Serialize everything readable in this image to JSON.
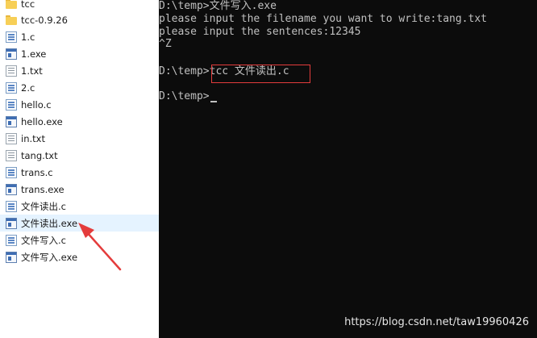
{
  "explorer": {
    "files": [
      {
        "name": "tcc",
        "icon": "folder-icon"
      },
      {
        "name": "tcc-0.9.26",
        "icon": "folder-icon"
      },
      {
        "name": "1.c",
        "icon": "c-source-file-icon"
      },
      {
        "name": "1.exe",
        "icon": "exe-file-icon"
      },
      {
        "name": "1.txt",
        "icon": "text-file-icon"
      },
      {
        "name": "2.c",
        "icon": "c-source-file-icon"
      },
      {
        "name": "hello.c",
        "icon": "c-source-file-icon"
      },
      {
        "name": "hello.exe",
        "icon": "exe-file-icon"
      },
      {
        "name": "in.txt",
        "icon": "text-file-icon"
      },
      {
        "name": "tang.txt",
        "icon": "text-file-icon"
      },
      {
        "name": "trans.c",
        "icon": "c-source-file-icon"
      },
      {
        "name": "trans.exe",
        "icon": "exe-file-icon"
      },
      {
        "name": "文件读出.c",
        "icon": "c-source-file-icon"
      },
      {
        "name": "文件读出.exe",
        "icon": "exe-file-icon",
        "selected": true
      },
      {
        "name": "文件写入.c",
        "icon": "c-source-file-icon"
      },
      {
        "name": "文件写入.exe",
        "icon": "exe-file-icon"
      }
    ]
  },
  "console": {
    "lines": [
      "D:\\temp>文件写入.exe",
      "please input the filename you want to write:tang.txt",
      "please input the sentences:12345",
      "^Z",
      "",
      "D:\\temp>tcc 文件读出.c",
      "",
      "D:\\temp>"
    ]
  },
  "annotation": {
    "box_color": "#e43c3c",
    "arrow_color": "#e43c3c"
  },
  "watermark": "https://blog.csdn.net/taw19960426"
}
